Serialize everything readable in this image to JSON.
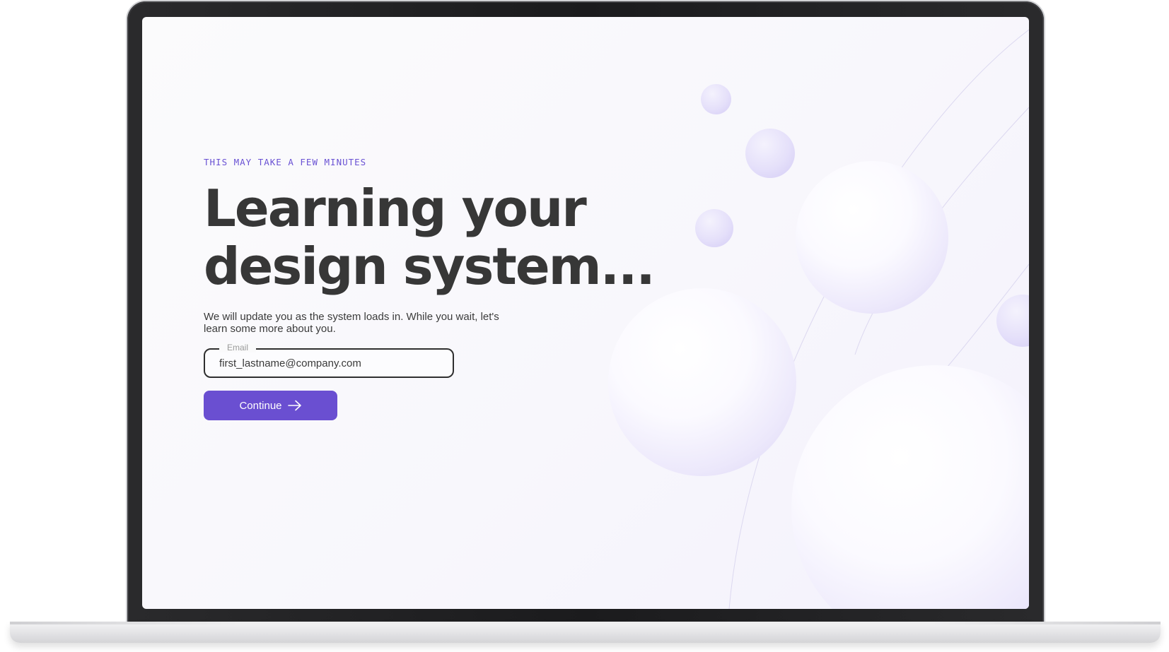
{
  "page": {
    "eyebrow": "THIS MAY TAKE A FEW MINUTES",
    "headline_line1": "Learning your",
    "headline_line2": "design system...",
    "subtitle": "We will update you as the system loads in. While you wait, let's learn some more about you."
  },
  "form": {
    "email_label": "Email",
    "email_value": "first_lastname@company.com",
    "continue_label": "Continue",
    "continue_icon": "arrow-right-icon"
  },
  "colors": {
    "accent": "#6a4fd1",
    "eyebrow": "#6a52d4",
    "headline": "#373737"
  }
}
